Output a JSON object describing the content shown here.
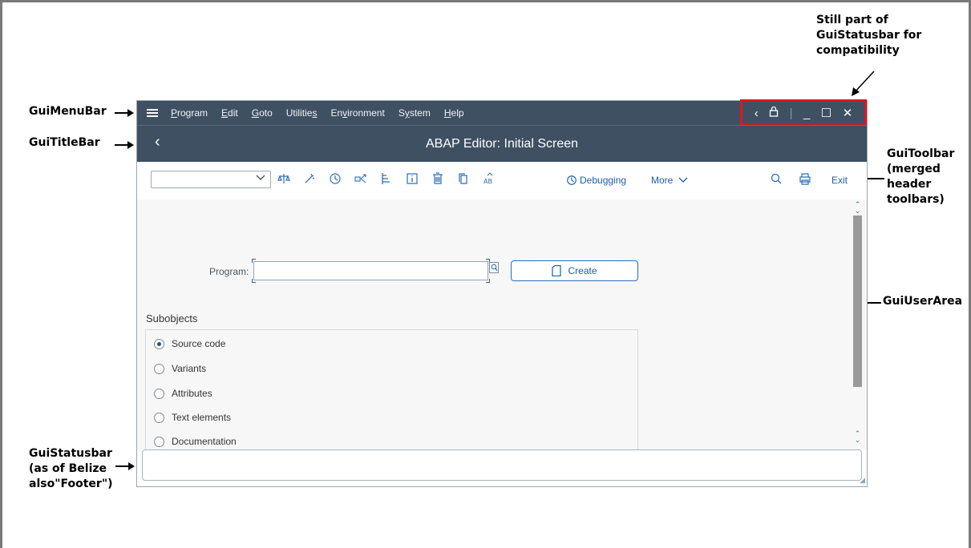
{
  "callouts": {
    "menubar": "GuiMenuBar",
    "titlebar": "GuiTitleBar",
    "statusbar_compat_1": "Still part of",
    "statusbar_compat_2": "GuiStatusbar for",
    "statusbar_compat_3": "compatibility",
    "toolbar_1": "GuiToolbar",
    "toolbar_2": "(merged",
    "toolbar_3": "header",
    "toolbar_4": "toolbars)",
    "userarea": "GuiUserArea",
    "statusbar_1": "GuiStatusbar",
    "statusbar_2": "(as of Belize",
    "statusbar_3": "also\"Footer\")"
  },
  "menubar": {
    "items": [
      {
        "prefix": "",
        "mnemonic": "P",
        "rest": "rogram"
      },
      {
        "prefix": "",
        "mnemonic": "E",
        "rest": "dit"
      },
      {
        "prefix": "",
        "mnemonic": "G",
        "rest": "oto"
      },
      {
        "prefix": "Utilitie",
        "mnemonic": "s",
        "rest": ""
      },
      {
        "prefix": "En",
        "mnemonic": "v",
        "rest": "ironment"
      },
      {
        "prefix": "S",
        "mnemonic": "y",
        "rest": "stem"
      },
      {
        "prefix": "",
        "mnemonic": "H",
        "rest": "elp"
      }
    ]
  },
  "window_controls": {
    "back": "‹",
    "lock": "⊡",
    "minimize": "_",
    "maximize": "☐",
    "close": "✕"
  },
  "titlebar": {
    "back": "‹",
    "title": "ABAP Editor: Initial Screen"
  },
  "toolbar": {
    "transaction_value": "",
    "icons": [
      "check-icon",
      "activate-icon",
      "history-icon",
      "where-used-icon",
      "hierarchy-icon",
      "info-icon",
      "delete-icon",
      "copy-icon",
      "rename-icon"
    ],
    "debugging": "Debugging",
    "more": "More",
    "exit": "Exit"
  },
  "form": {
    "program_label": "Program:",
    "program_value": "",
    "create_label": "Create",
    "subobjects_title": "Subobjects",
    "subobjects": [
      {
        "label": "Source code",
        "selected": true
      },
      {
        "label": "Variants",
        "selected": false
      },
      {
        "label": "Attributes",
        "selected": false
      },
      {
        "label": "Text elements",
        "selected": false
      },
      {
        "label": "Documentation",
        "selected": false
      }
    ]
  },
  "footer": {
    "message": ""
  },
  "colors": {
    "shell_header": "#3e5062",
    "accent": "#2b6fb3",
    "highlight_box": "#e0141e"
  }
}
